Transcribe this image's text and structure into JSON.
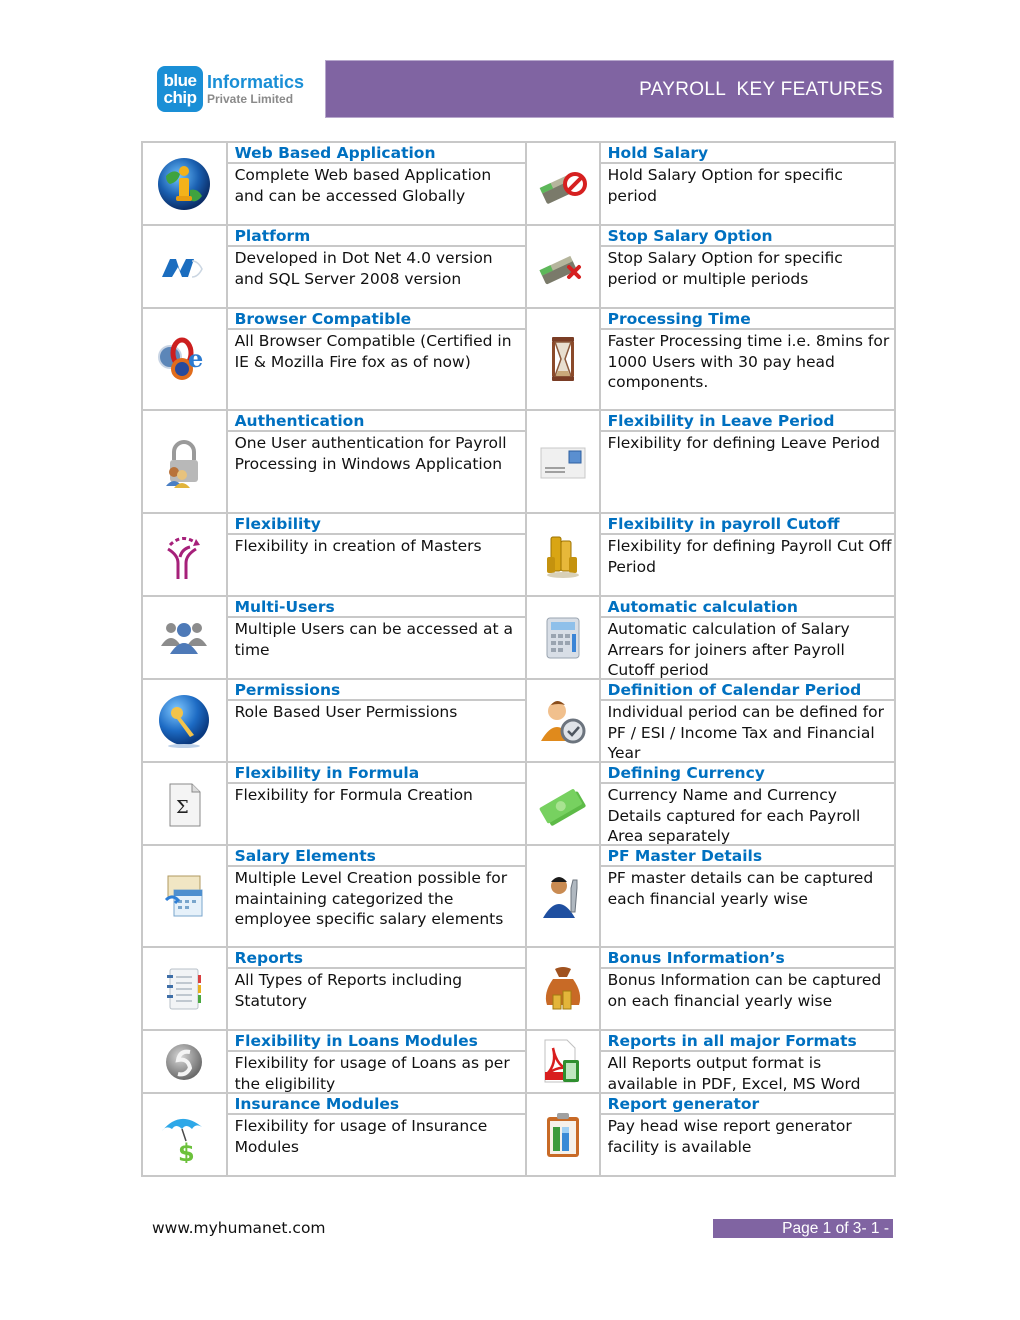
{
  "header": {
    "logo": {
      "mark_line1": "blue",
      "mark_line2": "chip",
      "name": "Informatics",
      "subtitle": "Private Limited"
    },
    "banner_title": "PAYROLL  KEY FEATURES",
    "banner_color": "#8064a2"
  },
  "colors": {
    "title_blue": "#0070c0",
    "grid_border": "#c8c8c8",
    "banner_purple": "#8064a2"
  },
  "features": [
    {
      "left": {
        "icon": "globe-info-icon",
        "title": "Web Based Application",
        "description": "Complete Web based Application and can be accessed Globally"
      },
      "right": {
        "icon": "money-hold-icon",
        "title": "Hold Salary",
        "description": "Hold Salary Option for specific period"
      }
    },
    {
      "left": {
        "icon": "dotnet-logo-icon",
        "title": "Platform",
        "description": "Developed in Dot Net 4.0 version and SQL Server 2008 version"
      },
      "right": {
        "icon": "money-stop-icon",
        "title": "Stop Salary Option",
        "description": "Stop Salary Option for specific period or multiple periods"
      }
    },
    {
      "left": {
        "icon": "browsers-icon",
        "title": "Browser Compatible",
        "description": "All Browser Compatible (Certified in IE & Mozilla Fire fox as of now)"
      },
      "right": {
        "icon": "hourglass-icon",
        "title": "Processing Time",
        "description": "Faster Processing time i.e. 8mins for 1000 Users with 30 pay head components."
      }
    },
    {
      "left": {
        "icon": "padlock-users-icon",
        "title": "Authentication",
        "description": "One User authentication for Payroll Processing in Windows Application"
      },
      "right": {
        "icon": "envelope-stamp-icon",
        "title": "Flexibility in Leave Period",
        "description": "Flexibility for defining Leave Period"
      }
    },
    {
      "left": {
        "icon": "branching-arrows-icon",
        "title": "Flexibility",
        "description": "Flexibility in creation of Masters"
      },
      "right": {
        "icon": "coin-stacks-icon",
        "title": "Flexibility in payroll Cutoff",
        "description": "Flexibility for defining Payroll Cut Off Period"
      }
    },
    {
      "left": {
        "icon": "users-group-icon",
        "title": "Multi-Users",
        "description": "Multiple Users can be accessed at a time"
      },
      "right": {
        "icon": "calculator-icon",
        "title": "Automatic calculation",
        "description": "Automatic calculation of Salary Arrears for joiners after Payroll Cutoff period"
      }
    },
    {
      "left": {
        "icon": "key-orb-icon",
        "title": "Permissions",
        "description": "Role Based User Permissions"
      },
      "right": {
        "icon": "user-clock-icon",
        "title": "Definition of Calendar Period",
        "description": "Individual period can be defined for PF / ESI / Income Tax and Financial Year"
      }
    },
    {
      "left": {
        "icon": "sigma-document-icon",
        "title": "Flexibility in Formula",
        "description": "Flexibility for Formula Creation"
      },
      "right": {
        "icon": "banknotes-icon",
        "title": "Defining Currency",
        "description": "Currency Name and Currency Details captured for each Payroll Area separately"
      }
    },
    {
      "left": {
        "icon": "calendar-sheet-icon",
        "title": "Salary Elements",
        "description": "Multiple Level Creation possible for maintaining categorized the employee specific salary elements"
      },
      "right": {
        "icon": "user-wrench-icon",
        "title": "PF Master Details",
        "description": "PF master details can be captured each financial yearly wise"
      }
    },
    {
      "left": {
        "icon": "notebook-icon",
        "title": "Reports",
        "description": "All Types of Reports including Statutory"
      },
      "right": {
        "icon": "money-bag-icon",
        "title": "Bonus Information’s",
        "description": "Bonus Information can be captured on each financial yearly wise"
      }
    },
    {
      "left": {
        "icon": "refresh-circle-icon",
        "title": "Flexibility in Loans Modules",
        "description": "Flexibility for usage of Loans as per the eligibility"
      },
      "right": {
        "icon": "pdf-excel-icon",
        "title": "Reports in all major Formats",
        "description": "All Reports output format is available in PDF, Excel, MS Word"
      }
    },
    {
      "left": {
        "icon": "umbrella-dollar-icon",
        "title": "Insurance Modules",
        "description": "Flexibility for usage of Insurance Modules"
      },
      "right": {
        "icon": "clipboard-chart-icon",
        "title": "Report generator",
        "description": "Pay head wise report generator facility is available"
      }
    }
  ],
  "footer": {
    "url": "www.myhumanet.com",
    "page_label": "Page 1 of 3",
    "page_suffix": "- 1 -"
  }
}
